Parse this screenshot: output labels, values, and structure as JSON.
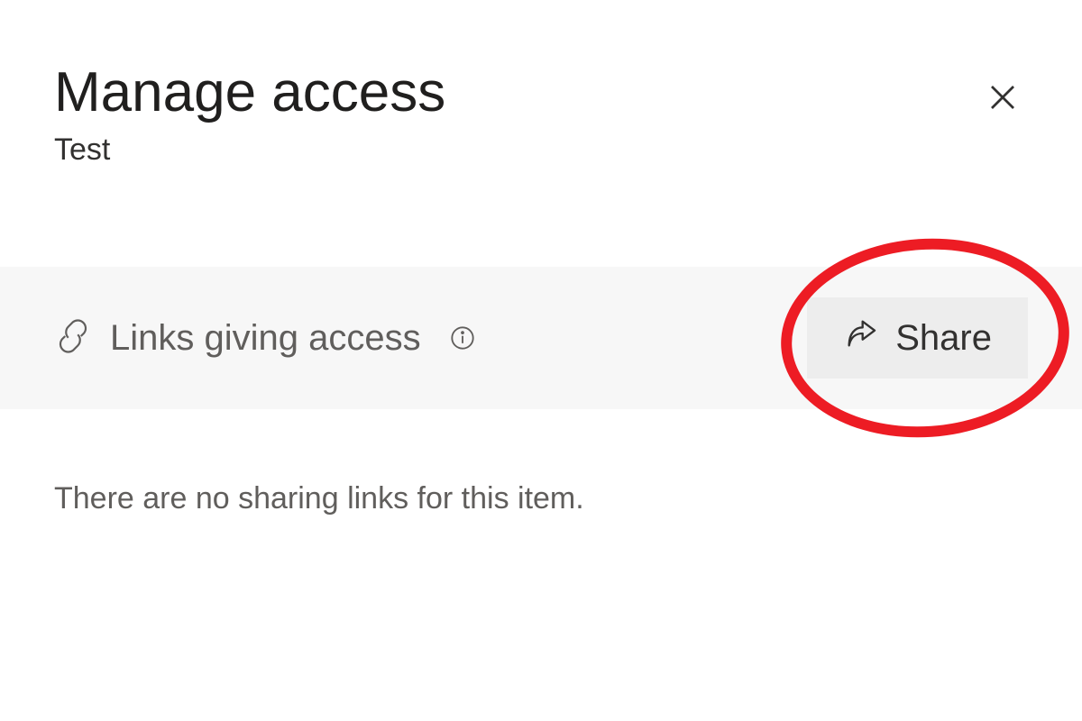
{
  "header": {
    "title": "Manage access",
    "subtitle": "Test"
  },
  "icons": {
    "close": "close-icon",
    "link": "link-icon",
    "info": "info-icon",
    "share": "share-arrow-icon"
  },
  "links_section": {
    "title": "Links giving access",
    "share_label": "Share"
  },
  "empty_state": {
    "message": "There are no sharing links for this item."
  },
  "annotation": {
    "highlight": "share-button-circled",
    "color": "#ed1c24"
  }
}
